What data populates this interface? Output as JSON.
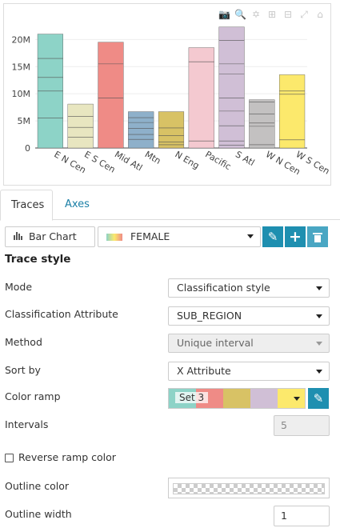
{
  "modebar": {
    "icons": [
      "camera-icon",
      "zoom-icon",
      "pan-icon",
      "zoom-in-icon",
      "zoom-out-icon",
      "autoscale-icon",
      "reset-icon"
    ]
  },
  "chart_data": {
    "type": "bar",
    "stacked": true,
    "categories": [
      "E N Cen",
      "E S Cen",
      "Mid Atl",
      "Mtn",
      "N Eng",
      "Pacific",
      "S Atl",
      "W N Cen",
      "W S Cen"
    ],
    "values": [
      21000000,
      8100000,
      19500000,
      6700000,
      6700000,
      18500000,
      22300000,
      8900000,
      13500000
    ],
    "segments": [
      [
        5500000,
        10500000,
        13000000,
        16500000,
        21000000
      ],
      [
        2000000,
        3800000,
        5800000,
        8100000
      ],
      [
        9200000,
        15500000,
        19500000
      ],
      [
        1600000,
        2500000,
        3600000,
        4700000,
        5600000,
        6700000
      ],
      [
        600000,
        1100000,
        2300000,
        3700000,
        6700000
      ],
      [
        1300000,
        15900000,
        18500000
      ],
      [
        500000,
        1300000,
        4100000,
        6800000,
        9200000,
        13600000,
        15500000,
        19800000,
        22300000
      ],
      [
        600000,
        4000000,
        4600000,
        6300000,
        8500000,
        8900000
      ],
      [
        1500000,
        9900000,
        10500000,
        13500000
      ]
    ],
    "colors": [
      "#8dd3c7",
      "#e8e6c0",
      "#ef8b86",
      "#8eb0ca",
      "#d8c265",
      "#f4c9d0",
      "#d0bfd6",
      "#c3c1c1",
      "#fce96c"
    ],
    "ylim": [
      0,
      23000000
    ],
    "yticks": [
      0,
      5000000,
      10000000,
      15000000,
      20000000
    ],
    "ytick_labels": [
      "0",
      "5M",
      "10M",
      "15M",
      "20M"
    ],
    "grid": true
  },
  "tabs": [
    {
      "label": "Traces"
    },
    {
      "label": "Axes"
    }
  ],
  "trace_bar": {
    "type_label": "Bar Chart",
    "trace_label": "FEMALE"
  },
  "trace_style": {
    "heading": "Trace style",
    "mode_label": "Mode",
    "mode_value": "Classification style",
    "class_attr_label": "Classification Attribute",
    "class_attr_value": "SUB_REGION",
    "method_label": "Method",
    "method_value": "Unique interval",
    "sort_label": "Sort by",
    "sort_value": "X Attribute",
    "ramp_label": "Color ramp",
    "ramp_value": "Set 3",
    "ramp_colors": [
      "#8dd3c7",
      "#ef8b86",
      "#d8c265",
      "#d0bfd6",
      "#fce96c"
    ],
    "intervals_label": "Intervals",
    "intervals_value": "5",
    "reverse_label": "Reverse ramp color",
    "outline_color_label": "Outline color",
    "outline_width_label": "Outline width",
    "outline_width_value": "1"
  }
}
